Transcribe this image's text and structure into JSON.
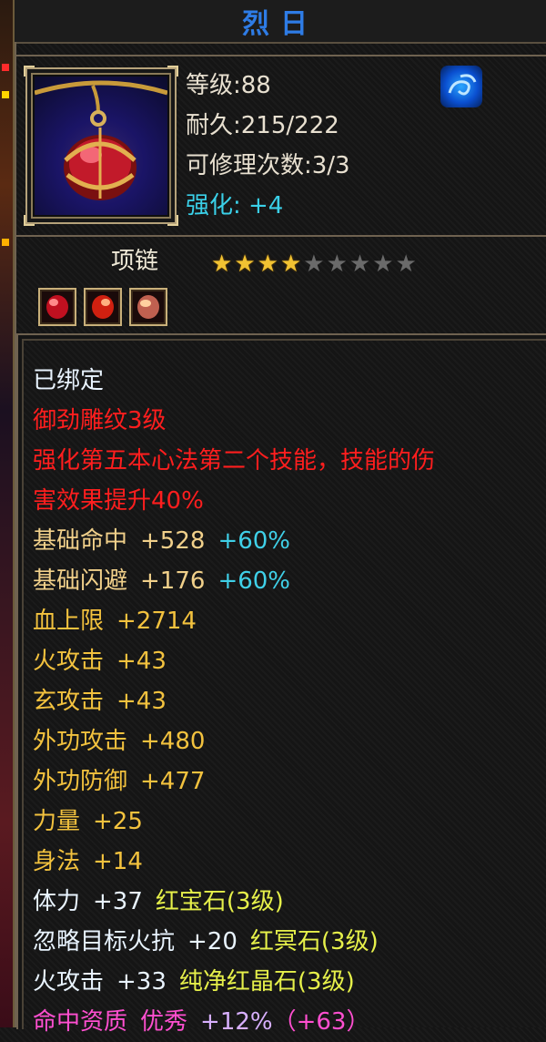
{
  "title": "烈日",
  "item": {
    "icon": "red-pendant-necklace-icon",
    "level": "等级:88",
    "durability": "耐久:215/222",
    "repair_count": "可修理次数:3/3",
    "enhance": "强化: +4",
    "type": "项链",
    "star_rating": 4,
    "star_max": 9,
    "class_icon": "blue-swirl-class-icon",
    "gems": [
      {
        "name": "red-gem-icon"
      },
      {
        "name": "red-gem-icon"
      },
      {
        "name": "pink-gem-icon"
      }
    ]
  },
  "details": {
    "bound": "已绑定",
    "engraving": "御劲雕纹3级",
    "effect_line1": "强化第五本心法第二个技能，技能的伤",
    "effect_line2": "害效果提升40%",
    "stats": [
      {
        "name": "基础命中",
        "value": "+528",
        "bonus": "+60%"
      },
      {
        "name": "基础闪避",
        "value": "+176",
        "bonus": "+60%"
      },
      {
        "name": "血上限",
        "value": "+2714",
        "bonus": ""
      },
      {
        "name": "火攻击",
        "value": "+43",
        "bonus": ""
      },
      {
        "name": "玄攻击",
        "value": "+43",
        "bonus": ""
      },
      {
        "name": "外功攻击",
        "value": "+480",
        "bonus": ""
      },
      {
        "name": "外功防御",
        "value": "+477",
        "bonus": ""
      },
      {
        "name": "力量",
        "value": "+25",
        "bonus": ""
      },
      {
        "name": "身法",
        "value": "+14",
        "bonus": ""
      }
    ],
    "gem_stats": [
      {
        "stat": "体力",
        "value": "+37",
        "gem": "红宝石(3级)"
      },
      {
        "stat": "忽略目标火抗",
        "value": "+20",
        "gem": "红冥石(3级)"
      },
      {
        "stat": "火攻击",
        "value": "+33",
        "gem": "纯净红晶石(3级)"
      }
    ],
    "aptitude": {
      "label": "命中资质",
      "grade": "优秀",
      "pct": "+12%",
      "bonus": "（+63）"
    }
  },
  "colors": {
    "title": "#2e7ce6",
    "bound": "#e9f4ff",
    "effect": "#ff1e1e",
    "stat": "#f1d08a",
    "bonus": "#3fd0e8",
    "gem": "#e6f04a",
    "aptitude": "#ff4fd0"
  }
}
